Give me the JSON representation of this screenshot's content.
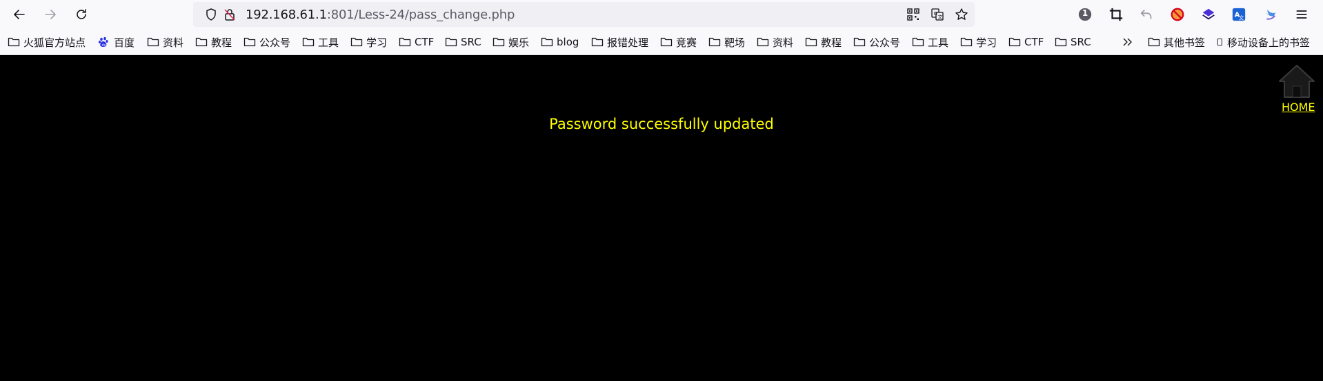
{
  "browser": {
    "url_host": "192.168.61.1",
    "url_rest": ":801/Less-24/pass_change.php",
    "badge_count": "1",
    "icons": [
      "back-icon",
      "forward-icon",
      "reload-icon",
      "shield-icon",
      "insecure-lock-icon",
      "qr-code-icon",
      "translate-icon",
      "star-icon",
      "counter-badge-icon",
      "crop-icon",
      "undo-icon",
      "blocked-extension-icon",
      "stack-extension-icon",
      "translate-extension-icon",
      "bird-extension-icon",
      "menu-icon"
    ]
  },
  "bookmarks": {
    "items": [
      {
        "label": "火狐官方站点",
        "icon": "firefox-icon"
      },
      {
        "label": "百度",
        "icon": "baidu-paw-icon"
      },
      {
        "label": "资料",
        "icon": "folder-icon"
      },
      {
        "label": "教程",
        "icon": "folder-icon"
      },
      {
        "label": "公众号",
        "icon": "folder-icon"
      },
      {
        "label": "工具",
        "icon": "folder-icon"
      },
      {
        "label": "学习",
        "icon": "folder-icon"
      },
      {
        "label": "CTF",
        "icon": "folder-icon"
      },
      {
        "label": "SRC",
        "icon": "folder-icon"
      },
      {
        "label": "娱乐",
        "icon": "folder-icon"
      },
      {
        "label": "blog",
        "icon": "folder-icon"
      },
      {
        "label": "报错处理",
        "icon": "folder-icon"
      },
      {
        "label": "竞赛",
        "icon": "folder-icon"
      },
      {
        "label": "靶场",
        "icon": "folder-icon"
      },
      {
        "label": "资料",
        "icon": "folder-icon"
      },
      {
        "label": "教程",
        "icon": "folder-icon"
      },
      {
        "label": "公众号",
        "icon": "folder-icon"
      },
      {
        "label": "工具",
        "icon": "folder-icon"
      },
      {
        "label": "学习",
        "icon": "folder-icon"
      },
      {
        "label": "CTF",
        "icon": "folder-icon"
      },
      {
        "label": "SRC",
        "icon": "folder-icon"
      }
    ],
    "other": "其他书签",
    "mobile": "移动设备上的书签"
  },
  "page": {
    "message": "Password successfully updated",
    "home_label": "HOME",
    "colors": {
      "background": "#000000",
      "text": "#ffff00"
    }
  }
}
